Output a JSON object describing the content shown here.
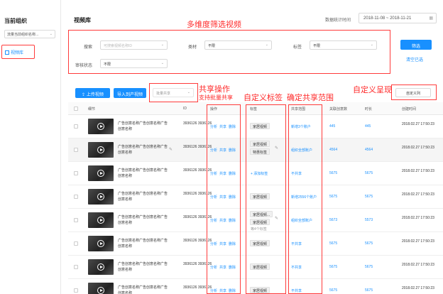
{
  "sidebar": {
    "title": "当前组织",
    "org_select": "流量当前组织名称...",
    "nav_item": "视频库"
  },
  "header": {
    "title": "视频库",
    "stat_label": "数据统计时间",
    "date_range": "2018-11-08 ~ 2018-11-21"
  },
  "annotations": {
    "filter": "多维度筛选视频",
    "share_op": "共享操作",
    "share_op_sub": "支持批量共享",
    "custom_tag": "自定义标签",
    "share_scope": "确定共享范围",
    "custom_show": "自定义呈现"
  },
  "filters": {
    "search_label": "搜索",
    "search_placeholder": "可搜索视频名称ID",
    "material_label": "类材",
    "material_value": "不限",
    "tag_label": "标签",
    "tag_value": "不限",
    "review_label": "审核状态",
    "review_value": "不限",
    "filter_button": "筛选",
    "clear_link": "清空已选"
  },
  "toolbar": {
    "upload": "上传视频",
    "import": "导入到产视频",
    "batch_share": "批量共享",
    "custom_columns": "自定义列"
  },
  "columns": [
    "细节",
    "ID",
    "操作",
    "标签",
    "共享范围",
    "关联创意数",
    "时长",
    "创建时间"
  ],
  "ops": [
    "分析",
    "共享",
    "删除"
  ],
  "rows": [
    {
      "title": "广告创意名称广告创意名称广告创意名称",
      "id": "3936126 3936126",
      "tags": [
        "家居视频"
      ],
      "share": "新增3个账户",
      "n1": "445",
      "n2": "445",
      "date": "2018.02.27 17:50:23"
    },
    {
      "title": "广告创意名称广告创意名称广告创意名称",
      "id": "3936126 3936126",
      "tags": [
        "家居视频",
        "特惠标签"
      ],
      "share": "组织全部账户",
      "n1": "4564",
      "n2": "4564",
      "date": "2018.02.27 17:50:23"
    },
    {
      "title": "广告创意名称广告创意名称广告创意名称",
      "id": "3936126 3936126",
      "tags": [],
      "add": "+ 添加标签",
      "share": "不共享",
      "n1": "5675",
      "n2": "5675",
      "date": "2018.02.27 17:50:23"
    },
    {
      "title": "广告创意名称广告创意名称广告创意名称",
      "id": "3936126 3936126",
      "tags": [
        "家居视频"
      ],
      "share": "新增2556个账户",
      "n1": "5675",
      "n2": "5675",
      "date": "2018.02.27 17:50:23"
    },
    {
      "title": "广告创意名称广告创意名称广告创意名称",
      "id": "3936126 3936126",
      "tags": [
        "家居视频...",
        "家居视频"
      ],
      "more": "等4个标签",
      "share": "组织全部账户",
      "n1": "5673",
      "n2": "5573",
      "date": "2018.02.27 17:50:23"
    },
    {
      "title": "广告创意名称广告创意名称广告创意名称",
      "id": "3936126 3936126",
      "tags": [
        "家居视频"
      ],
      "share": "不共享",
      "n1": "5675",
      "n2": "5675",
      "date": "2018.02.27 17:50:23"
    },
    {
      "title": "广告创意名称广告创意名称广告创意名称",
      "id": "3936126 3936126",
      "tags": [
        "家居视频"
      ],
      "share": "不共享",
      "n1": "5675",
      "n2": "5675",
      "date": "2018.02.27 17:50:23"
    },
    {
      "title": "广告创意名称广告创意名称广告创意名称",
      "id": "3936126 3936126",
      "tags": [
        "家居视频"
      ],
      "share": "不共享",
      "n1": "5675",
      "n2": "5675",
      "date": "2018.02.27 17:50:23"
    }
  ]
}
